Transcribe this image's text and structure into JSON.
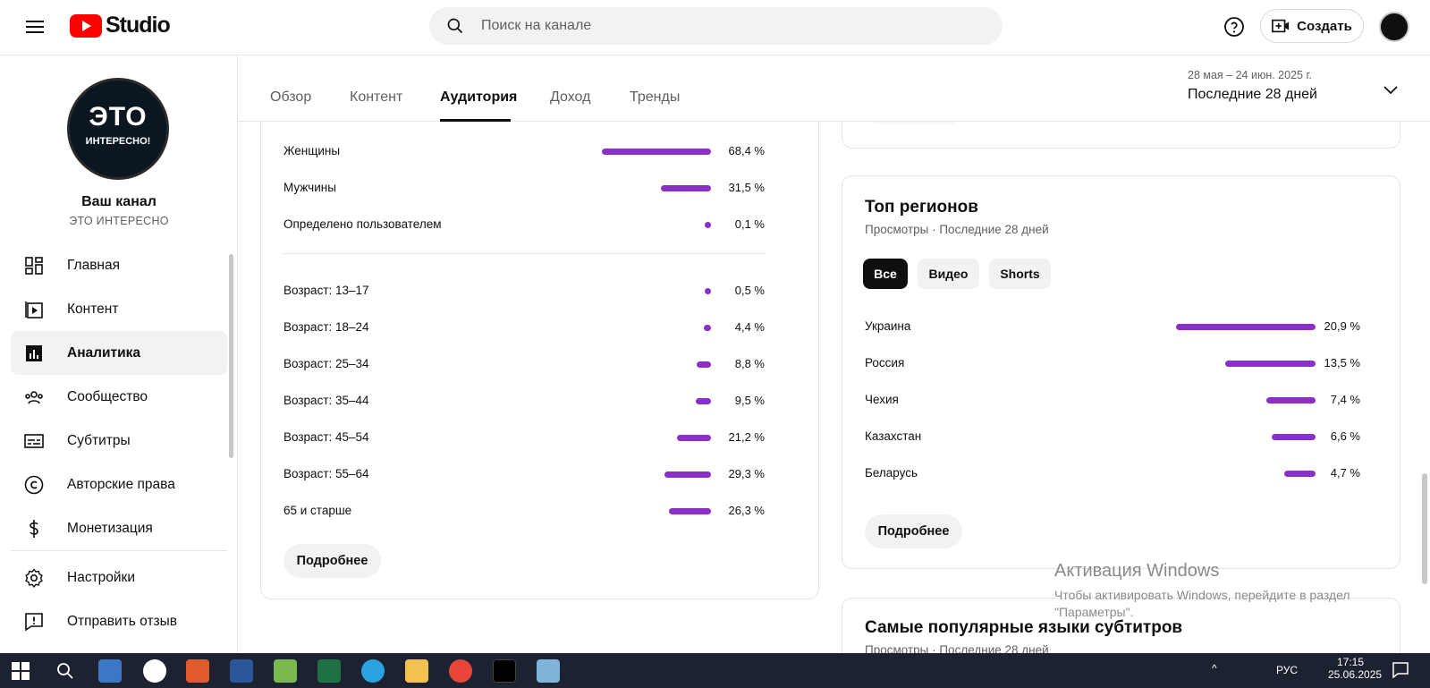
{
  "header": {
    "logo_text": "Studio",
    "search_placeholder": "Поиск на канале",
    "create_label": "Создать"
  },
  "sidebar": {
    "avatar_line1": "ЭТО",
    "avatar_line2": "ИНТЕРЕСНО!",
    "channel_name": "Ваш канал",
    "channel_handle": "ЭТО ИНТЕРЕСНО",
    "items": [
      {
        "label": "Главная",
        "icon": "dashboard-icon"
      },
      {
        "label": "Контент",
        "icon": "content-icon"
      },
      {
        "label": "Аналитика",
        "icon": "analytics-icon",
        "active": true
      },
      {
        "label": "Сообщество",
        "icon": "community-icon"
      },
      {
        "label": "Субтитры",
        "icon": "subtitles-icon"
      },
      {
        "label": "Авторские права",
        "icon": "copyright-icon"
      },
      {
        "label": "Монетизация",
        "icon": "monetization-icon"
      }
    ],
    "bottom_items": [
      {
        "label": "Настройки",
        "icon": "gear-icon"
      },
      {
        "label": "Отправить отзыв",
        "icon": "feedback-icon"
      }
    ]
  },
  "tabs": [
    {
      "label": "Обзор"
    },
    {
      "label": "Контент"
    },
    {
      "label": "Аудитория",
      "active": true
    },
    {
      "label": "Доход"
    },
    {
      "label": "Тренды"
    }
  ],
  "date_range": {
    "dates": "28 мая – 24 июн. 2025 г.",
    "period": "Последние 28 дней"
  },
  "demographics": {
    "gender": [
      {
        "label": "Женщины",
        "value": "68,4 %",
        "pct": 68.4
      },
      {
        "label": "Мужчины",
        "value": "31,5 %",
        "pct": 31.5
      },
      {
        "label": "Определено пользователем",
        "value": "0,1 %",
        "pct": 0.1
      }
    ],
    "age": [
      {
        "label": "Возраст: 13–17",
        "value": "0,5 %",
        "pct": 0.5
      },
      {
        "label": "Возраст: 18–24",
        "value": "4,4 %",
        "pct": 4.4
      },
      {
        "label": "Возраст: 25–34",
        "value": "8,8 %",
        "pct": 8.8
      },
      {
        "label": "Возраст: 35–44",
        "value": "9,5 %",
        "pct": 9.5
      },
      {
        "label": "Возраст: 45–54",
        "value": "21,2 %",
        "pct": 21.2
      },
      {
        "label": "Возраст: 55–64",
        "value": "29,3 %",
        "pct": 29.3
      },
      {
        "label": "65 и старше",
        "value": "26,3 %",
        "pct": 26.3
      }
    ],
    "more_label": "Подробнее"
  },
  "regions": {
    "title": "Топ регионов",
    "subtitle": "Просмотры · Последние 28 дней",
    "chips": [
      {
        "label": "Все",
        "active": true
      },
      {
        "label": "Видео"
      },
      {
        "label": "Shorts"
      }
    ],
    "items": [
      {
        "label": "Украина",
        "value": "20,9 %",
        "pct": 20.9
      },
      {
        "label": "Россия",
        "value": "13,5 %",
        "pct": 13.5
      },
      {
        "label": "Чехия",
        "value": "7,4 %",
        "pct": 7.4
      },
      {
        "label": "Казахстан",
        "value": "6,6 %",
        "pct": 6.6
      },
      {
        "label": "Беларусь",
        "value": "4,7 %",
        "pct": 4.7
      }
    ],
    "more_label": "Подробнее"
  },
  "subtitles_card": {
    "title": "Самые популярные языки субтитров",
    "subtitle": "Просмотры · Последние 28 дней"
  },
  "watermark": {
    "line1": "Активация Windows",
    "line2": "Чтобы активировать Windows, перейдите в раздел",
    "line3": "\"Параметры\"."
  },
  "taskbar": {
    "lang": "РУС",
    "time": "17:15",
    "date": "25.06.2025"
  },
  "colors": {
    "accent_bar": "#8b2fc9",
    "youtube_red": "#ff0000"
  }
}
